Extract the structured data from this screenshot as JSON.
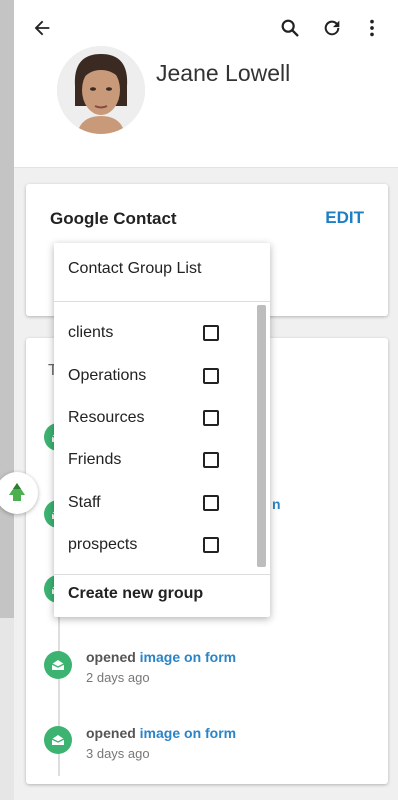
{
  "header": {
    "contact_name": "Jeane Lowell",
    "icons": [
      "arrow-back-icon",
      "search-icon",
      "refresh-icon",
      "more-vert-icon"
    ]
  },
  "google_card": {
    "title": "Google Contact",
    "edit_label": "EDIT"
  },
  "activity_card": {
    "partial_letter": "T",
    "peek_text": "n",
    "events": [
      {
        "verb": "opened",
        "object": "image on form",
        "time": "2 days ago"
      },
      {
        "verb": "opened",
        "object": "image on form",
        "time": "3 days ago"
      }
    ]
  },
  "group_menu": {
    "header": "Contact Group List",
    "items": [
      {
        "label": "clients",
        "checked": false
      },
      {
        "label": "Operations",
        "checked": false
      },
      {
        "label": "Resources",
        "checked": false
      },
      {
        "label": "Friends",
        "checked": false
      },
      {
        "label": "Staff",
        "checked": false
      },
      {
        "label": "prospects",
        "checked": false
      }
    ],
    "create_label": "Create new group"
  },
  "colors": {
    "accent_blue": "#1e7fc3",
    "timeline_green": "#3cb371",
    "fab_green": "#4caf50"
  }
}
